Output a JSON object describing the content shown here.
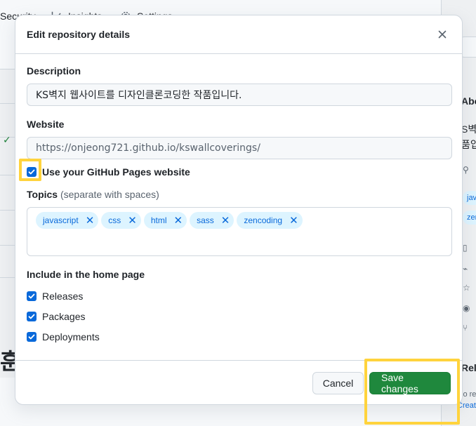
{
  "background": {
    "nav": {
      "security": "Security",
      "insights": "Insights",
      "settings": "Settings"
    },
    "left_big_char": "훈",
    "right_panel": {
      "about_fragment": "Abo",
      "desc_fragment_1": "S벽",
      "desc_fragment_2": "품입",
      "topic_fragment_1": "jav",
      "topic_fragment_2": "zen",
      "releases_fragment": "Rele",
      "releases_sub_fragment": "lo re",
      "create_fragment": "Creat"
    }
  },
  "modal": {
    "title": "Edit repository details",
    "description": {
      "label": "Description",
      "value": "KS벽지 웹사이트를 디자인클론코딩한 작품입니다."
    },
    "website": {
      "label": "Website",
      "value": "https://onjeong721.github.io/kswallcoverings/"
    },
    "use_pages": {
      "label": "Use your GitHub Pages website",
      "checked": true
    },
    "topics": {
      "label": "Topics",
      "hint": "(separate with spaces)",
      "items": [
        "javascript",
        "css",
        "html",
        "sass",
        "zencoding"
      ]
    },
    "home_page": {
      "label": "Include in the home page",
      "options": [
        {
          "label": "Releases",
          "checked": true
        },
        {
          "label": "Packages",
          "checked": true
        },
        {
          "label": "Deployments",
          "checked": true
        }
      ]
    },
    "footer": {
      "cancel": "Cancel",
      "save": "Save changes"
    }
  },
  "colors": {
    "accent": "#0969da",
    "save_green": "#1f883d",
    "highlight": "#ffd33d"
  }
}
